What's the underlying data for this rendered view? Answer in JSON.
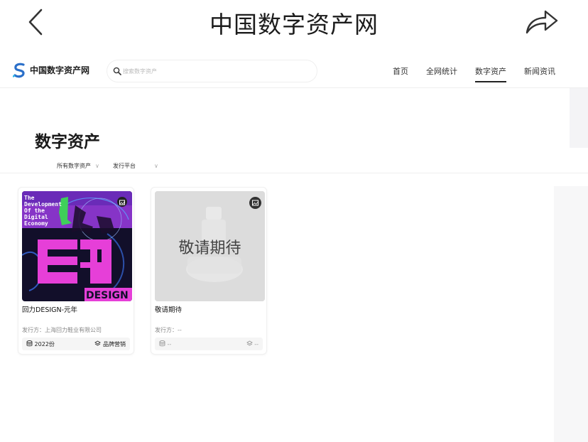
{
  "appbar": {
    "title": "中国数字资产网",
    "back_icon": "chevron-left-icon",
    "share_icon": "share-icon"
  },
  "header": {
    "logo_text": "中国数字资产网",
    "search_placeholder": "搜索数字资产",
    "nav": [
      {
        "label": "首页"
      },
      {
        "label": "全网统计"
      },
      {
        "label": "数字资产",
        "active": true
      },
      {
        "label": "新闻资讯"
      }
    ]
  },
  "page": {
    "title": "数字资产"
  },
  "filters": [
    {
      "label": "所有数字资产"
    },
    {
      "label": "发行平台"
    }
  ],
  "cards": [
    {
      "name": "回力DESIGN-元年",
      "issuer": "发行方：上海回力鞋业有限公司",
      "year": "2022份",
      "category": "品牌营销",
      "image_text": [
        "The",
        "Development",
        "Of the",
        "Digital",
        "Economy"
      ],
      "design_text": "DESIGN",
      "colors": {
        "magenta": "#e63fd8",
        "dark": "#120f2a"
      }
    },
    {
      "name": "敬请期待",
      "issuer": "发行方：--",
      "year": "--",
      "category": "--",
      "placeholder_text": "敬请期待"
    }
  ]
}
